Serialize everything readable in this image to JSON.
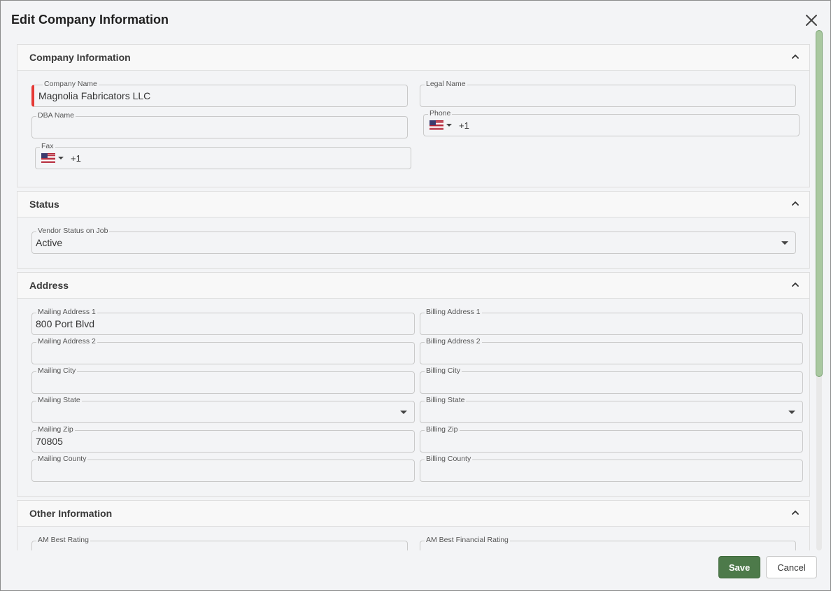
{
  "dialog": {
    "title": "Edit Company Information"
  },
  "sections": {
    "company": {
      "title": "Company Information",
      "company_name": {
        "label": "Company Name",
        "value": "Magnolia Fabricators LLC"
      },
      "legal_name": {
        "label": "Legal Name",
        "value": ""
      },
      "dba_name": {
        "label": "DBA Name",
        "value": ""
      },
      "phone": {
        "label": "Phone",
        "code": "+1"
      },
      "fax": {
        "label": "Fax",
        "code": "+1"
      }
    },
    "status": {
      "title": "Status",
      "vendor_status": {
        "label": "Vendor Status on Job",
        "value": "Active"
      }
    },
    "address": {
      "title": "Address",
      "mailing_address_1": {
        "label": "Mailing Address 1",
        "value": "800 Port Blvd"
      },
      "billing_address_1": {
        "label": "Billing Address 1",
        "value": ""
      },
      "mailing_address_2": {
        "label": "Mailing Address 2",
        "value": ""
      },
      "billing_address_2": {
        "label": "Billing Address 2",
        "value": ""
      },
      "mailing_city": {
        "label": "Mailing City",
        "value": ""
      },
      "billing_city": {
        "label": "Billing City",
        "value": ""
      },
      "mailing_state": {
        "label": "Mailing State",
        "value": ""
      },
      "billing_state": {
        "label": "Billing State",
        "value": ""
      },
      "mailing_zip": {
        "label": "Mailing Zip",
        "value": "70805"
      },
      "billing_zip": {
        "label": "Billing Zip",
        "value": ""
      },
      "mailing_county": {
        "label": "Mailing County",
        "value": ""
      },
      "billing_county": {
        "label": "Billing County",
        "value": ""
      }
    },
    "other": {
      "title": "Other Information",
      "am_best_rating": {
        "label": "AM Best Rating",
        "value": ""
      },
      "am_best_financial_rating": {
        "label": "AM Best Financial Rating",
        "value": ""
      }
    }
  },
  "footer": {
    "save_label": "Save",
    "cancel_label": "Cancel"
  },
  "icons": {
    "close": "close-icon",
    "collapse": "chevron-up-icon",
    "dropdown": "caret-down-icon",
    "flag": "us-flag-icon"
  },
  "colors": {
    "primary": "#4d7a4a",
    "required": "#e53935",
    "scroll_thumb": "#a9c8a0"
  }
}
